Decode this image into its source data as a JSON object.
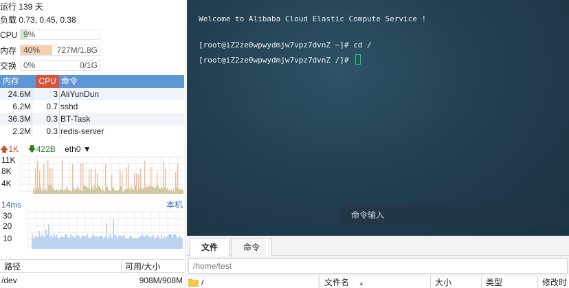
{
  "monitor": {
    "uptime": "运行 139 天",
    "load": "负载 0.73, 0.45, 0.38",
    "cpu": {
      "label": "CPU",
      "value": "9%",
      "percent": 9
    },
    "memory": {
      "label": "内存",
      "value": "40%",
      "detail": "727M/1.8G",
      "percent": 40
    },
    "swap": {
      "label": "交换",
      "value": "0%",
      "detail": "0/1G",
      "percent": 0
    },
    "process_table": {
      "headers": {
        "mem": "内存",
        "cpu": "CPU",
        "cmd": "命令"
      },
      "rows": [
        {
          "mem": "24.6M",
          "cpu": "3",
          "cmd": "AliYunDun"
        },
        {
          "mem": "6.2M",
          "cpu": "0.7",
          "cmd": "sshd"
        },
        {
          "mem": "36.3M",
          "cpu": "0.3",
          "cmd": "BT-Task"
        },
        {
          "mem": "2.2M",
          "cpu": "0.3",
          "cmd": "redis-server"
        }
      ]
    },
    "network": {
      "up": "1K",
      "down": "422B",
      "interface": "eth0",
      "y_ticks": [
        "11K",
        "8K",
        "4K"
      ]
    },
    "latency": {
      "value": "14ms",
      "host": "本机",
      "y_ticks": [
        "30",
        "20",
        "10"
      ]
    },
    "disk": {
      "headers": {
        "path": "路径",
        "usage": "可用/大小"
      },
      "rows": [
        {
          "path": "/dev",
          "usage": "908M/908M"
        }
      ]
    }
  },
  "terminal": {
    "lines": [
      "Welcome to Alibaba Cloud Elastic Compute Service !",
      "[root@iZ2ze0wpwydmjw7vpz7dvnZ ~]# cd /",
      "[root@iZ2ze0wpwydmjw7vpz7dvnZ /]# "
    ],
    "command_input_placeholder": "命令输入"
  },
  "file_panel": {
    "tabs": [
      "文件",
      "命令"
    ],
    "path": "/home/test",
    "tree_root": "/",
    "columns": [
      "文件名",
      "大小",
      "类型",
      "修改时"
    ]
  },
  "colors": {
    "cpu_bar": "#cfe8cf",
    "mem_bar": "#f6cfae",
    "header_blue": "#5f97d4",
    "header_red": "#d9533a",
    "net_up": "#e8a47c",
    "net_down": "#8cbf7b",
    "latency_fill": "#bcd3ef",
    "cursor": "#27d07a"
  }
}
